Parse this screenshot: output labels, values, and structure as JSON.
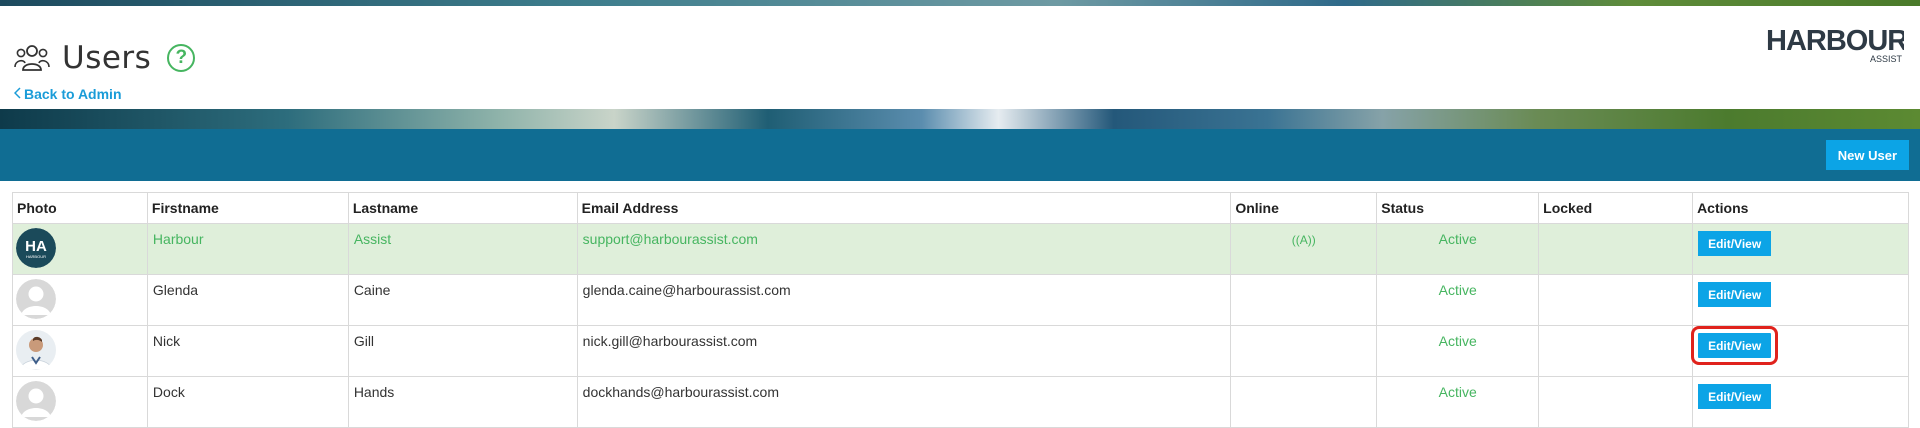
{
  "header": {
    "title": "Users",
    "help_label": "?",
    "back_label": "Back to Admin",
    "logo_text": "HARBOUR",
    "logo_sub": "ASSIST"
  },
  "toolbar": {
    "new_user_label": "New User"
  },
  "table": {
    "columns": [
      "Photo",
      "Firstname",
      "Lastname",
      "Email Address",
      "Online",
      "Status",
      "Locked",
      "Actions"
    ],
    "rows": [
      {
        "avatar": "harbour-logo",
        "firstname": "Harbour",
        "lastname": "Assist",
        "email": "support@harbourassist.com",
        "online": "((A))",
        "status": "Active",
        "locked": "",
        "action": "Edit/View",
        "highlight": true
      },
      {
        "avatar": "default",
        "firstname": "Glenda",
        "lastname": "Caine",
        "email": "glenda.caine@harbourassist.com",
        "online": "",
        "status": "Active",
        "locked": "",
        "action": "Edit/View",
        "highlight": false
      },
      {
        "avatar": "photo",
        "firstname": "Nick",
        "lastname": "Gill",
        "email": "nick.gill@harbourassist.com",
        "online": "",
        "status": "Active",
        "locked": "",
        "action": "Edit/View",
        "highlight": false,
        "focused": true
      },
      {
        "avatar": "default",
        "firstname": "Dock",
        "lastname": "Hands",
        "email": "dockhands@harbourassist.com",
        "online": "",
        "status": "Active",
        "locked": "",
        "action": "Edit/View",
        "highlight": false
      }
    ]
  },
  "avatar_logo_text": "HA",
  "avatar_logo_sub": "HARBOUR",
  "colors": {
    "accent": "#0ca4e6",
    "toolbar": "#106d93",
    "active": "#46b560",
    "highlight_row": "#dfefda",
    "focus": "#e0221c"
  }
}
